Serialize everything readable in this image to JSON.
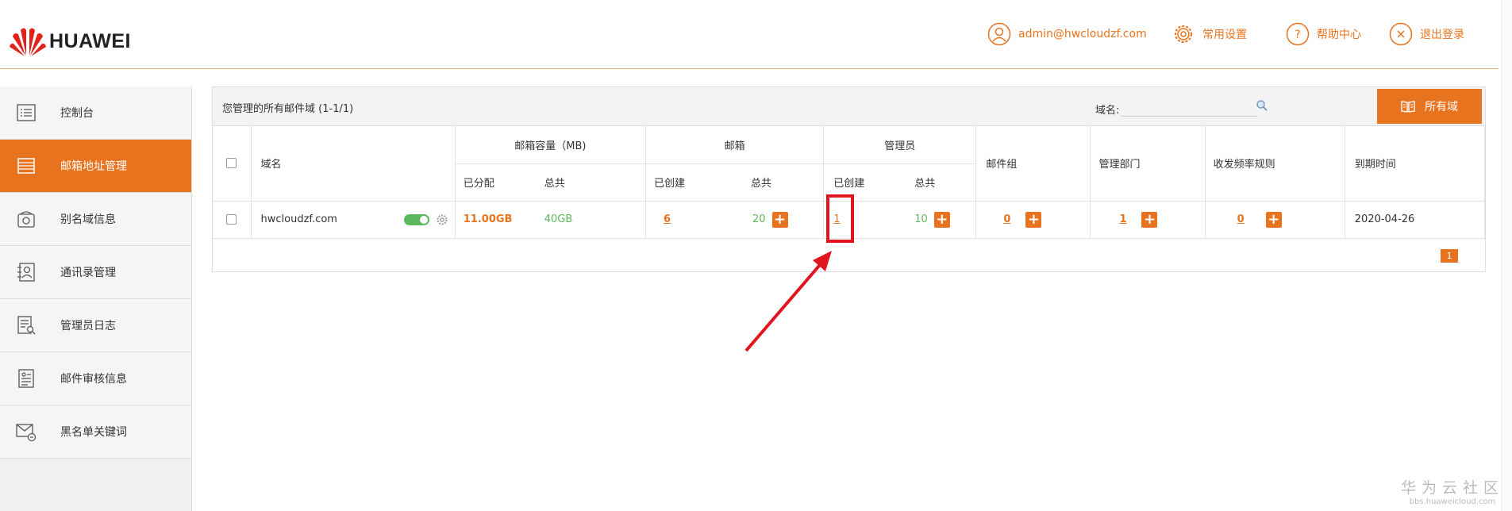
{
  "brand": {
    "name": "HUAWEI",
    "color": "#e8731f"
  },
  "header": {
    "user": {
      "label": "admin@hwcloudzf.com",
      "icon": "user-icon"
    },
    "settings": {
      "label": "常用设置",
      "icon": "gear-icon"
    },
    "help": {
      "label": "帮助中心",
      "icon": "question-icon"
    },
    "logout": {
      "label": "退出登录",
      "icon": "close-circle-icon"
    }
  },
  "sidebar": {
    "items": [
      {
        "label": "控制台",
        "icon": "list-icon",
        "active": false
      },
      {
        "label": "邮箱地址管理",
        "icon": "stack-icon",
        "active": true
      },
      {
        "label": "别名域信息",
        "icon": "phone-icon",
        "active": false
      },
      {
        "label": "通讯录管理",
        "icon": "contact-icon",
        "active": false
      },
      {
        "label": "管理员日志",
        "icon": "log-search-icon",
        "active": false
      },
      {
        "label": "邮件审核信息",
        "icon": "audit-doc-icon",
        "active": false
      },
      {
        "label": "黑名单关键词",
        "icon": "mail-lock-icon",
        "active": false
      }
    ]
  },
  "panel": {
    "title": "您管理的所有邮件域 (1-1/1)",
    "domain_filter_label": "域名:",
    "domain_filter_value": "",
    "all_domains_button": "所有域"
  },
  "table": {
    "headers": {
      "domain": "域名",
      "capacity": "邮箱容量（MB)",
      "capacity_allocated": "已分配",
      "capacity_total": "总共",
      "mailbox": "邮箱",
      "mailbox_created": "已创建",
      "mailbox_total": "总共",
      "admin": "管理员",
      "admin_created": "已创建",
      "admin_total": "总共",
      "mail_group": "邮件组",
      "dept": "管理部门",
      "freq_rule": "收发频率规则",
      "expiry": "到期时间"
    },
    "row": {
      "domain": "hwcloudzf.com",
      "capacity_allocated": "11.00GB",
      "capacity_total": "40GB",
      "mailbox_created": "6",
      "mailbox_total": "20",
      "admin_created": "1",
      "admin_total": "10",
      "mail_group": "0",
      "dept": "1",
      "freq_rule": "0",
      "expiry": "2020-04-26",
      "enabled": true
    },
    "pagination": {
      "current_page": "1"
    }
  },
  "watermark": {
    "title": "华为云社区",
    "url": "bbs.huaweicloud.com"
  }
}
